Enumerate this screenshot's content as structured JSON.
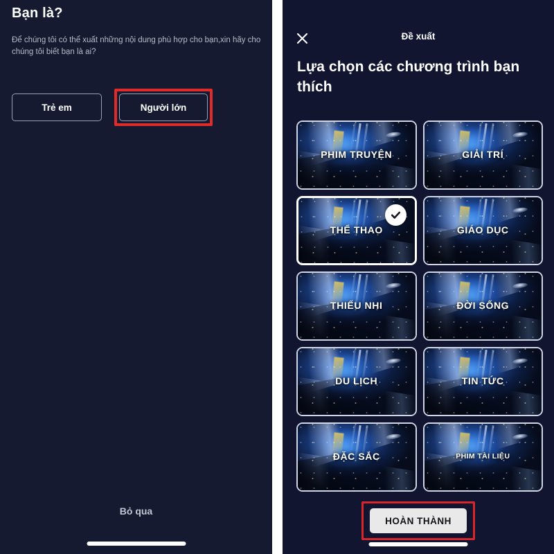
{
  "left_panel": {
    "title": "Bạn là?",
    "subtitle": "Để chúng tôi có thể xuất những nội dung phù hợp cho bạn,xin hãy cho chúng tôi biết bạn là ai?",
    "buttons": {
      "kid": "Trẻ em",
      "adult": "Người lớn"
    },
    "highlighted_button": "Người lớn",
    "skip_label": "Bỏ qua"
  },
  "right_panel": {
    "header_title": "Đề xuất",
    "close_icon": "close-icon",
    "page_title": "Lựa chọn các chương trình bạn thích",
    "tiles": [
      {
        "label": "PHIM TRUYỆN",
        "selected": false,
        "small": false
      },
      {
        "label": "GIẢI TRÍ",
        "selected": false,
        "small": false
      },
      {
        "label": "THỂ THAO",
        "selected": true,
        "small": false
      },
      {
        "label": "GIÁO DỤC",
        "selected": false,
        "small": false
      },
      {
        "label": "THIẾU NHI",
        "selected": false,
        "small": false
      },
      {
        "label": "ĐỜI SỐNG",
        "selected": false,
        "small": false
      },
      {
        "label": "DU LỊCH",
        "selected": false,
        "small": false
      },
      {
        "label": "TIN TỨC",
        "selected": false,
        "small": false
      },
      {
        "label": "ĐẶC SẮC",
        "selected": false,
        "small": false
      },
      {
        "label": "PHIM TÀI LIỆU",
        "selected": false,
        "small": true
      }
    ],
    "selected_badge_icon": "check-icon",
    "done_label": "HOÀN THÀNH",
    "highlighted_button": "HOÀN THÀNH"
  },
  "colors": {
    "left_background": "#151a30",
    "right_background": "#111530",
    "highlight_red": "#e02b2b",
    "done_button_bg": "#e9e9e9",
    "text_primary": "#ffffff",
    "text_secondary": "#b7bcc9"
  }
}
